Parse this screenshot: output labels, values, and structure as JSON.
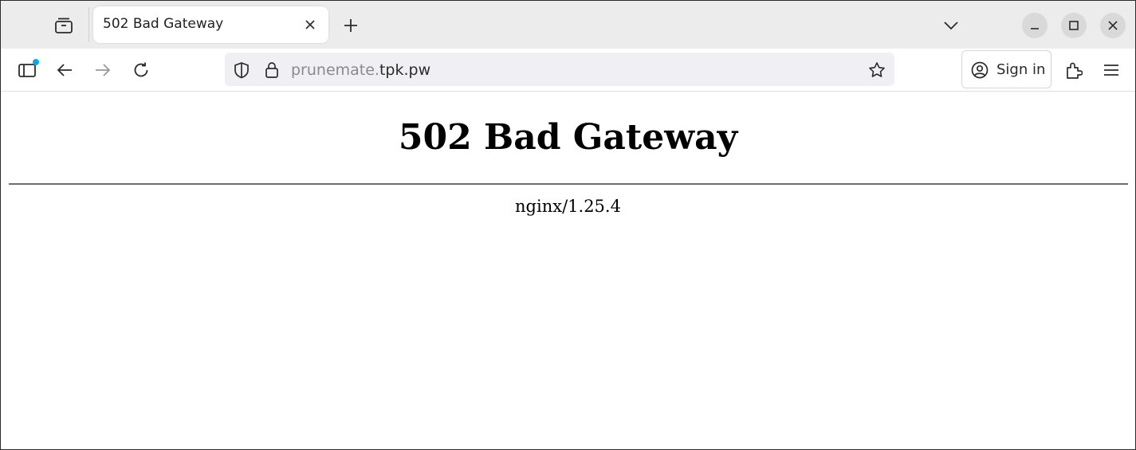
{
  "browser": {
    "tab": {
      "title": "502 Bad Gateway",
      "close_icon": "close-icon"
    },
    "new_tab_icon": "plus-icon",
    "list_tabs_icon": "chevron-down-icon",
    "window_controls": [
      "minimize-icon",
      "maximize-icon",
      "close-icon"
    ],
    "nav": {
      "back_icon": "arrow-left-icon",
      "forward_icon": "arrow-right-icon",
      "reload_icon": "reload-icon"
    },
    "url": {
      "subdomain": "prunemate.",
      "domain": "tpk.pw"
    },
    "sign_in_label": "Sign in",
    "accent_color": "#0ea5e9"
  },
  "page": {
    "heading": "502 Bad Gateway",
    "server": "nginx/1.25.4"
  }
}
